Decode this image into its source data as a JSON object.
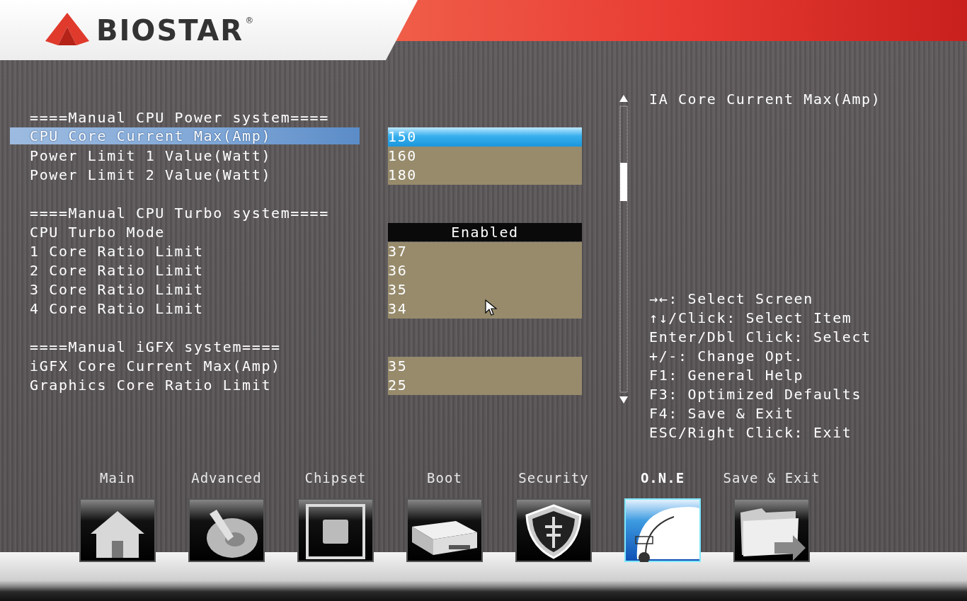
{
  "header": {
    "brand": "BIOSTAR",
    "trademark": "®"
  },
  "groups": [
    {
      "heading": "====Manual CPU Power system====",
      "items": [
        {
          "label": "CPU Core Current Max(Amp)",
          "kind": "number",
          "value": "150",
          "selected": true
        },
        {
          "label": "Power Limit 1 Value(Watt)",
          "kind": "number",
          "value": "160",
          "selected": false
        },
        {
          "label": "Power Limit 2 Value(Watt)",
          "kind": "number",
          "value": "180",
          "selected": false
        }
      ]
    },
    {
      "heading": "====Manual CPU Turbo system====",
      "items": [
        {
          "label": "CPU Turbo Mode",
          "kind": "option",
          "value": "Enabled",
          "selected": false
        },
        {
          "label": "1 Core Ratio Limit",
          "kind": "number",
          "value": "37",
          "selected": false
        },
        {
          "label": "2 Core Ratio Limit",
          "kind": "number",
          "value": "36",
          "selected": false
        },
        {
          "label": "3 Core Ratio Limit",
          "kind": "number",
          "value": "35",
          "selected": false
        },
        {
          "label": "4 Core Ratio Limit",
          "kind": "number",
          "value": "34",
          "selected": false
        }
      ]
    },
    {
      "heading": "====Manual iGFX system====",
      "items": [
        {
          "label": "iGFX Core Current Max(Amp)",
          "kind": "number",
          "value": "35",
          "selected": false
        },
        {
          "label": "Graphics Core Ratio Limit",
          "kind": "number",
          "value": "25",
          "selected": false
        }
      ]
    }
  ],
  "help": {
    "title": "IA Core Current Max(Amp)",
    "keys": [
      "→←: Select Screen",
      "↑↓/Click: Select Item",
      "Enter/Dbl Click: Select",
      "+/-: Change Opt.",
      "F1: General Help",
      "F3: Optimized Defaults",
      "F4: Save & Exit",
      "ESC/Right Click: Exit"
    ]
  },
  "tabs": [
    {
      "label": "Main",
      "kind": "home",
      "selected": false
    },
    {
      "label": "Advanced",
      "kind": "toggle",
      "selected": false
    },
    {
      "label": "Chipset",
      "kind": "chip",
      "selected": false
    },
    {
      "label": "Boot",
      "kind": "drive",
      "selected": false
    },
    {
      "label": "Security",
      "kind": "shield",
      "selected": false
    },
    {
      "label": "O.N.E",
      "kind": "gauge",
      "selected": true
    },
    {
      "label": "Save & Exit",
      "kind": "folder",
      "selected": false
    }
  ]
}
